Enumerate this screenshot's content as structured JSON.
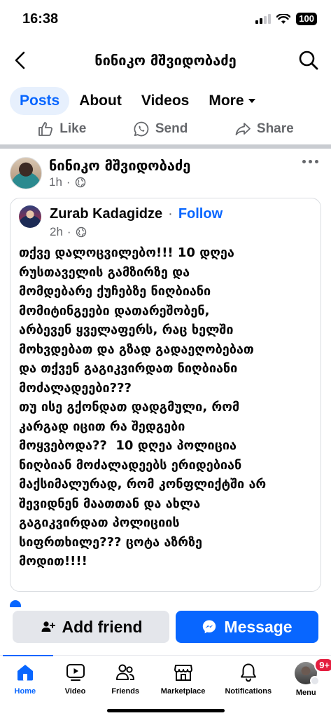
{
  "status_bar": {
    "time": "16:38",
    "battery": "100"
  },
  "header": {
    "title": "ნინიკო მშვიდობაძე"
  },
  "tabs": [
    {
      "label": "Posts",
      "active": true
    },
    {
      "label": "About"
    },
    {
      "label": "Videos"
    },
    {
      "label": "More"
    }
  ],
  "actions": {
    "like": "Like",
    "send": "Send",
    "share": "Share"
  },
  "post": {
    "author": "ნინიკო მშვიდობაძე",
    "time": "1h",
    "shared": {
      "author": "Zurab Kadagidze",
      "follow": "Follow",
      "time": "2h",
      "text": "თქვე დალოცვილებო!!! 10 დღეა\nრუსთაველის გამზირზე და\nმომდებარე ქუჩებზე ნიღბიანი\nმომიტინგეები დათარეშობენ,\nარბევენ ყველაფერს, რაც ხელში\nმოხვდებათ და გზად გადაეღობებათ\nდა თქვენ გაგიკვირდათ ნიღბიანი\nმოძალადეები???\nთუ ისე გქონდათ დადგმული, რომ\nკარგად იცით რა შედგები\nმოყვებოდა??  10 დღეა პოლიცია\nნიღბიან მოძალადეებს ერიდებიან\nმაქსიმალურად, რომ კონფლიქტში არ\nშევიდნენ მაათთან და ახლა\nგაგიკვირდათ პოლიციის\nსიფრთხილე??? ცოტა აზრზე\nმოდით!!!!"
    }
  },
  "buttons": {
    "add_friend": "Add friend",
    "message": "Message"
  },
  "nav": {
    "home": "Home",
    "video": "Video",
    "friends": "Friends",
    "marketplace": "Marketplace",
    "notifications": "Notifications",
    "menu": "Menu",
    "menu_badge": "9+"
  },
  "colors": {
    "accent": "#0866ff",
    "badge": "#e41e3f",
    "secondary_text": "#65676b"
  }
}
